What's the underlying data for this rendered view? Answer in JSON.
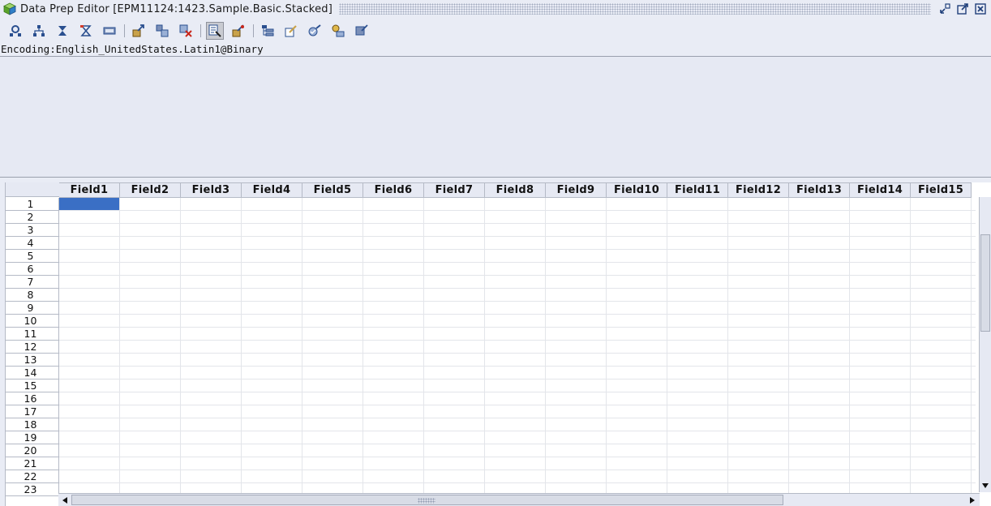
{
  "window": {
    "title": "Data Prep Editor [EPM11124:1423.Sample.Basic.Stacked]"
  },
  "toolbar": {
    "buttons": [
      {
        "icon": "field-properties-icon"
      },
      {
        "icon": "join-fields-icon"
      },
      {
        "icon": "create-field-join-icon"
      },
      {
        "icon": "create-field-text-icon"
      },
      {
        "icon": "split-field-icon"
      },
      {
        "icon": "associate-outline-icon"
      },
      {
        "icon": "dimension-build-icon"
      },
      {
        "icon": "delete-icon"
      },
      {
        "icon": "data-load-mode-icon",
        "active": true
      },
      {
        "icon": "ignore-field-icon"
      },
      {
        "icon": "outline-icon"
      },
      {
        "icon": "edit-properties-icon"
      },
      {
        "icon": "validate-icon"
      },
      {
        "icon": "key-icon"
      },
      {
        "icon": "dimension-properties-icon"
      }
    ]
  },
  "encoding": {
    "label": "Encoding:English_UnitedStates.Latin1@Binary"
  },
  "grid": {
    "columns": [
      "Field1",
      "Field2",
      "Field3",
      "Field4",
      "Field5",
      "Field6",
      "Field7",
      "Field8",
      "Field9",
      "Field10",
      "Field11",
      "Field12",
      "Field13",
      "Field14",
      "Field15"
    ],
    "rows": [
      "1",
      "2",
      "3",
      "4",
      "5",
      "6",
      "7",
      "8",
      "9",
      "10",
      "11",
      "12",
      "13",
      "14",
      "15",
      "16",
      "17",
      "18",
      "19",
      "20",
      "21",
      "22",
      "23"
    ],
    "selected_cell": {
      "row": "1",
      "column": "Field1"
    }
  },
  "colors": {
    "background": "#e9ecf5",
    "selection": "#3a6fc5",
    "grid_line": "#e3e5ea"
  }
}
